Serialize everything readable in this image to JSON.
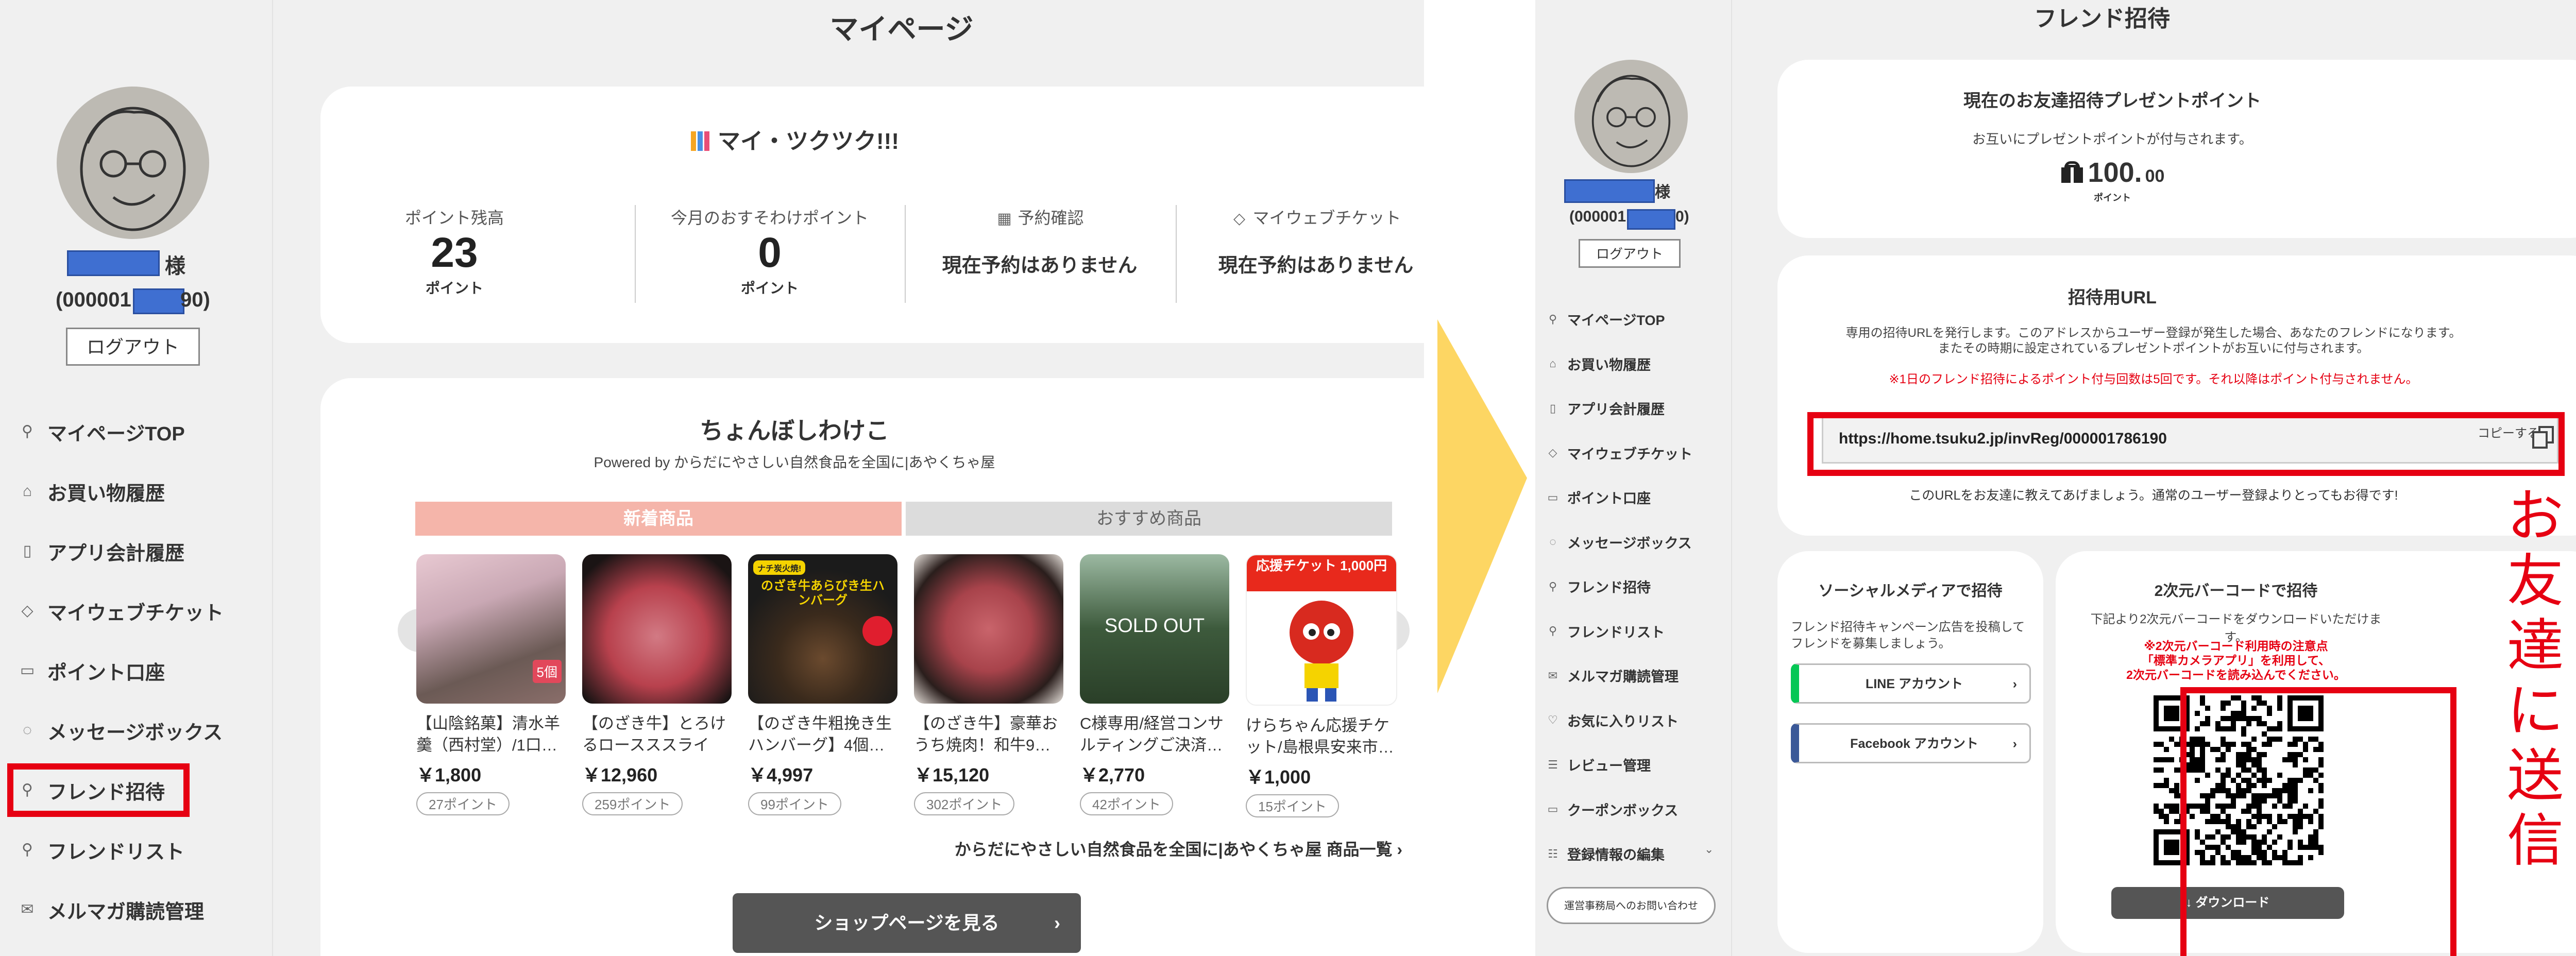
{
  "left": {
    "page_title": "マイページ",
    "user": {
      "name_suffix": "様",
      "id_prefix": "(000001",
      "id_suffix": "90)",
      "logout_label": "ログアウト"
    },
    "nav": [
      {
        "label": "マイページTOP",
        "icon": "person-icon"
      },
      {
        "label": "お買い物履歴",
        "icon": "shopping-bag-icon"
      },
      {
        "label": "アプリ会計履歴",
        "icon": "phone-icon"
      },
      {
        "label": "マイウェブチケット",
        "icon": "tag-icon"
      },
      {
        "label": "ポイント口座",
        "icon": "card-icon"
      },
      {
        "label": "メッセージボックス",
        "icon": "chat-icon"
      },
      {
        "label": "フレンド招待",
        "icon": "person-icon"
      },
      {
        "label": "フレンドリスト",
        "icon": "people-icon"
      },
      {
        "label": "メルマガ購読管理",
        "icon": "mail-icon"
      }
    ],
    "app_title": "マイ・ツクツク!!!",
    "stats": [
      {
        "label": "ポイント残高",
        "value": "23",
        "unit": "ポイント"
      },
      {
        "label": "今月のおすそわけポイント",
        "value": "0",
        "unit": "ポイント"
      },
      {
        "label": "予約確認",
        "value": "現在予約はありません",
        "icon": "calendar-icon"
      },
      {
        "label": "マイウェブチケット",
        "value": "現在予約はありません",
        "icon": "tag-icon"
      }
    ],
    "shop": {
      "title": "ちょんぼしわけこ",
      "powered": "Powered by からだにやさしい自然食品を全国に|あやくちゃ屋",
      "tabs": [
        "新着商品",
        "おすすめ商品"
      ],
      "products": [
        {
          "name": "【山陰銘菓】清水羊羹（西村堂）/1口…",
          "price": "￥1,800",
          "points": "27ポイント",
          "badge": ""
        },
        {
          "name": "【のざき牛】とろけるロースススライス…",
          "price": "￥12,960",
          "points": "259ポイント",
          "badge": ""
        },
        {
          "name": "【のざき牛粗挽き生ハンバーグ】4個…",
          "price": "￥4,997",
          "points": "99ポイント",
          "badge": "のざき牛あらびき生ハンバーグ"
        },
        {
          "name": "【のざき牛】豪華おうち焼肉！和牛9…",
          "price": "￥15,120",
          "points": "302ポイント",
          "badge": ""
        },
        {
          "name": "C様専用/経営コンサルティングご決済…",
          "price": "￥2,770",
          "points": "42ポイント",
          "badge": "SOLD OUT"
        },
        {
          "name": "けらちゃん応援チケット/島根県安来市…",
          "price": "￥1,000",
          "points": "15ポイント",
          "badge": "応援チケット 1,000円"
        }
      ],
      "list_link": "からだにやさしい自然食品を全国に|あやくちゃ屋 商品一覧",
      "shop_button": "ショップページを見る"
    }
  },
  "right": {
    "page_title": "フレンド招待",
    "user": {
      "name_suffix": "様",
      "id_prefix": "(000001",
      "id_suffix": "0)",
      "logout_label": "ログアウト"
    },
    "nav": [
      {
        "label": "マイページTOP",
        "icon": "person-icon"
      },
      {
        "label": "お買い物履歴",
        "icon": "shopping-bag-icon"
      },
      {
        "label": "アプリ会計履歴",
        "icon": "phone-icon"
      },
      {
        "label": "マイウェブチケット",
        "icon": "tag-icon"
      },
      {
        "label": "ポイント口座",
        "icon": "card-icon"
      },
      {
        "label": "メッセージボックス",
        "icon": "chat-icon"
      },
      {
        "label": "フレンド招待",
        "icon": "person-icon"
      },
      {
        "label": "フレンドリスト",
        "icon": "people-icon"
      },
      {
        "label": "メルマガ購読管理",
        "icon": "mail-icon"
      },
      {
        "label": "お気に入りリスト",
        "icon": "heart-icon"
      },
      {
        "label": "レビュー管理",
        "icon": "list-icon"
      },
      {
        "label": "クーポンボックス",
        "icon": "coupon-icon"
      },
      {
        "label": "登録情報の編集",
        "icon": "edit-icon"
      }
    ],
    "contact_button": "運営事務局へのお問い合わせ",
    "present": {
      "title": "現在のお友達招待プレゼントポイント",
      "desc": "お互いにプレゼントポイントが付与されます。",
      "value_int": "100.",
      "value_dec": "00",
      "unit": "ポイント"
    },
    "invite_url": {
      "title": "招待用URL",
      "desc1": "専用の招待URLを発行します。このアドレスからユーザー登録が発生した場合、あなたのフレンドになります。",
      "desc2": "またその時期に設定されているプレゼントポイントがお互いに付与されます。",
      "warning": "※1日のフレンド招待によるポイント付与回数は5回です。それ以降はポイント付与されません。",
      "url": "https://home.tsuku2.jp/invReg/000001786190",
      "copy_label": "コピーする",
      "note": "このURLをお友達に教えてあげましょう。通常のユーザー登録よりとってもお得です!"
    },
    "social": {
      "title": "ソーシャルメディアで招待",
      "desc": "フレンド招待キャンペーン広告を投稿してフレンドを募集しましょう。",
      "line_label": "LINE アカウント",
      "facebook_label": "Facebook アカウント"
    },
    "qr": {
      "title": "2次元バーコードで招待",
      "desc": "下記より2次元バーコードをダウンロードいただけます。",
      "warn1": "※2次元バーコード利用時の注意点",
      "warn2": "「標準カメラアプリ」を利用して、",
      "warn3": "2次元バーコードを読み込んでください。",
      "download_label": "ダウンロード"
    },
    "annotation": "お友達に送信"
  },
  "colors": {
    "red_box": "#e60012",
    "redact_blue": "#3f6fd1",
    "arrow_yellow": "#fdd663",
    "tab_active": "#f5b5aa",
    "line_green": "#06c755",
    "facebook_blue": "#3b5998"
  }
}
